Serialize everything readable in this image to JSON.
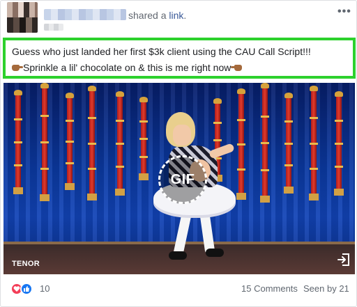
{
  "header": {
    "action_prefix": "shared a ",
    "action_link": "link",
    "action_suffix": ".",
    "more_label": "•••"
  },
  "message": {
    "line1": "Guess who just landed her first $3k client using the CAU Call Script!!!",
    "line2": "Sprinkle a lil' chocolate on & this is me right now",
    "highlight_color": "#2dd12d"
  },
  "media": {
    "badge_label": "GIF",
    "provider": "TENOR",
    "open_icon": "open-external-icon"
  },
  "footer": {
    "reaction_icons": [
      "love-reaction-icon",
      "like-reaction-icon"
    ],
    "reaction_count": "10",
    "comments": "15 Comments",
    "seen": "Seen by 21"
  },
  "colors": {
    "link": "#385898",
    "love": "#f33e58",
    "like": "#1877f2",
    "meta_text": "#606770"
  }
}
